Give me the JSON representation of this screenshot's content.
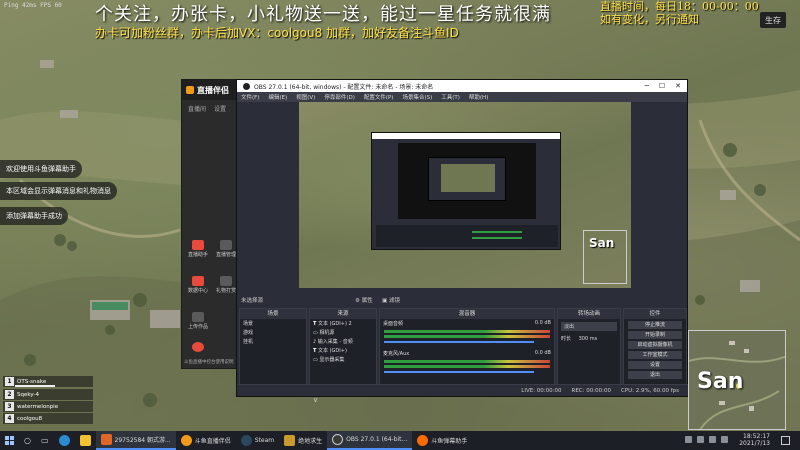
{
  "overlay": {
    "top_tiny": "Ping 42ms  FPS 60",
    "banner_line1": "个关注，办张卡，小礼物送一送，能过一星任务就很满",
    "banner_line2": "办卡可加粉丝群，办卡后加VX：coolgou8  加群，加好友备注斗鱼ID",
    "live_line1": "直播时间，每日18：00-00：00",
    "live_line2": "如有变化，另行通知",
    "save_label": "生存"
  },
  "notifications": [
    "欢迎使用斗鱼弹幕助手",
    "本区域会显示弹幕消息和礼物消息",
    "添加弹幕助手成功"
  ],
  "douyu_app": {
    "logo": "直播伴侣",
    "tabs": [
      "直播间",
      "设置"
    ],
    "side_items": [
      "直播助手",
      "直播管理",
      "数据中心",
      "礼物打赏",
      "上传作品",
      "斗鱼直播"
    ],
    "footer_notice": "斗鱼直播中控台使用说明"
  },
  "obs": {
    "title": "OBS 27.0.1 (64-bit, windows) - 配置文件: 未命名 - 场景: 未命名",
    "menu": [
      "文件(F)",
      "编辑(E)",
      "视图(V)",
      "停靠部件(D)",
      "配置文件(P)",
      "场景集合(S)",
      "工具(T)",
      "帮助(H)"
    ],
    "scene_label": "未选择源",
    "props_label": "属性",
    "filters_label": "滤镜",
    "docks": {
      "scenes": {
        "title": "场景",
        "items": [
          "场景",
          "游戏",
          "挂机"
        ]
      },
      "sources": {
        "title": "来源",
        "items": [
          "文本 (GDI+) 2",
          "相机源",
          "输入采集 - 音频",
          "文本 (GDI+)",
          "显示器采集"
        ]
      },
      "mixer": {
        "title": "混音器",
        "channels": [
          "桌面音频",
          "麦克风/Aux"
        ],
        "levels": [
          "0.0 dB",
          "0.0 dB"
        ]
      },
      "transitions": {
        "title": "转场动画",
        "type": "淡出",
        "duration_label": "时长",
        "duration": "300 ms"
      },
      "controls": {
        "title": "控件",
        "buttons": [
          "停止推流",
          "开始录制",
          "启动虚拟摄像机",
          "工作室模式",
          "设置",
          "退出"
        ]
      }
    },
    "status": [
      "LIVE: 00:00:00",
      "REC: 00:00:00",
      "CPU: 2.9%, 60.00 fps"
    ]
  },
  "players": [
    {
      "num": "1",
      "name": "OTS-snake"
    },
    {
      "num": "2",
      "name": "Sqeky-4"
    },
    {
      "num": "3",
      "name": "watermelonpie"
    },
    {
      "num": "4",
      "name": "coolgou8"
    }
  ],
  "minimap": {
    "town": "San"
  },
  "preview_town": "San",
  "taskbar": {
    "items": [
      {
        "label": "29752584 朝式游...",
        "color": "#e0672a"
      },
      {
        "label": "斗鱼直播伴侣",
        "color": "#f29a1a"
      },
      {
        "label": "Steam",
        "color": "#2a475e"
      },
      {
        "label": "绝地求生",
        "color": "#c99a2e"
      },
      {
        "label": "OBS 27.0.1 (64-bit...",
        "color": "#3a3a3a"
      },
      {
        "label": "斗鱼弹幕助手",
        "color": "#ff6a00"
      }
    ],
    "time": "18:52:17",
    "date": "2021/7/13"
  }
}
